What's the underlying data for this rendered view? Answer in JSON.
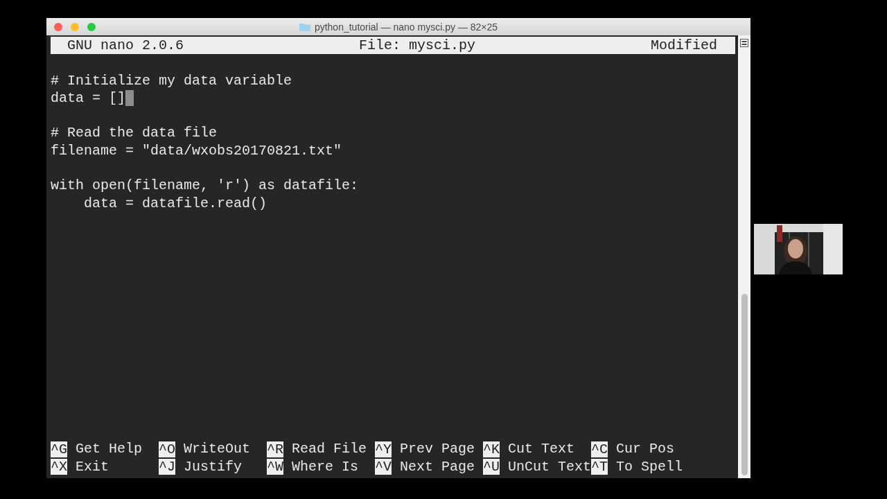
{
  "window": {
    "title": "python_tutorial — nano mysci.py — 82×25"
  },
  "nano_header": {
    "app": "GNU nano 2.0.6",
    "file": "File: mysci.py",
    "status": "Modified"
  },
  "code_blocks": [
    [
      {
        "text": "# Initialize my data variable",
        "cursor": false
      },
      {
        "text": "data = []",
        "cursor": true
      }
    ],
    [
      {
        "text": "# Read the data file",
        "cursor": false
      },
      {
        "text": "filename = \"data/wxobs20170821.txt\"",
        "cursor": false
      }
    ],
    [
      {
        "text": "with open(filename, 'r') as datafile:",
        "cursor": false
      },
      {
        "text": "    data = datafile.read()",
        "cursor": false
      }
    ]
  ],
  "shortcuts": [
    [
      {
        "key": "^G",
        "label": "Get Help"
      },
      {
        "key": "^X",
        "label": "Exit"
      }
    ],
    [
      {
        "key": "^O",
        "label": "WriteOut"
      },
      {
        "key": "^J",
        "label": "Justify"
      }
    ],
    [
      {
        "key": "^R",
        "label": "Read File"
      },
      {
        "key": "^W",
        "label": "Where Is"
      }
    ],
    [
      {
        "key": "^Y",
        "label": "Prev Page"
      },
      {
        "key": "^V",
        "label": "Next Page"
      }
    ],
    [
      {
        "key": "^K",
        "label": "Cut Text"
      },
      {
        "key": "^U",
        "label": "UnCut Text"
      }
    ],
    [
      {
        "key": "^C",
        "label": "Cur Pos"
      },
      {
        "key": "^T",
        "label": "To Spell"
      }
    ]
  ],
  "webcam": {
    "kind": "picture"
  }
}
